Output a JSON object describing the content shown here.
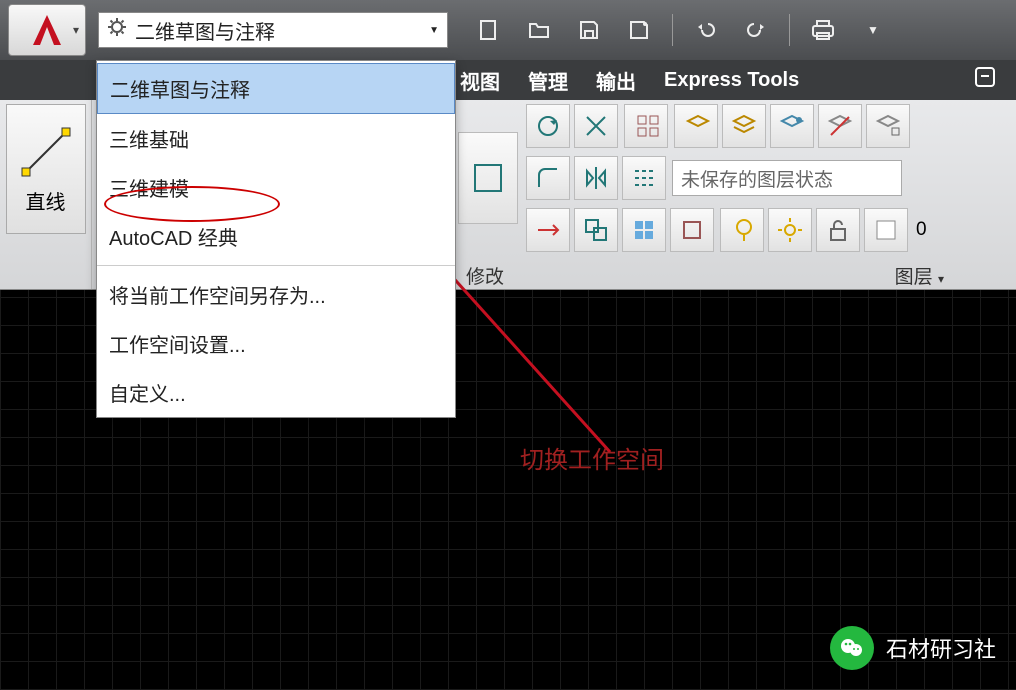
{
  "workspace": {
    "selected": "二维草图与注释",
    "menu": {
      "opt1": "二维草图与注释",
      "opt2": "三维基础",
      "opt3": "三维建模",
      "opt4": "AutoCAD 经典",
      "opt5": "将当前工作空间另存为...",
      "opt6": "工作空间设置...",
      "opt7": "自定义..."
    }
  },
  "tabs": {
    "t1": "视图",
    "t2": "管理",
    "t3": "输出",
    "t4": "Express Tools"
  },
  "ribbon": {
    "line_label": "直线",
    "panel_modify": "修改",
    "panel_layer": "图层",
    "layer_state": "未保存的图层状态",
    "zero": "0"
  },
  "annotation": {
    "text": "切换工作空间"
  },
  "watermark": {
    "text": "石材研习社"
  }
}
